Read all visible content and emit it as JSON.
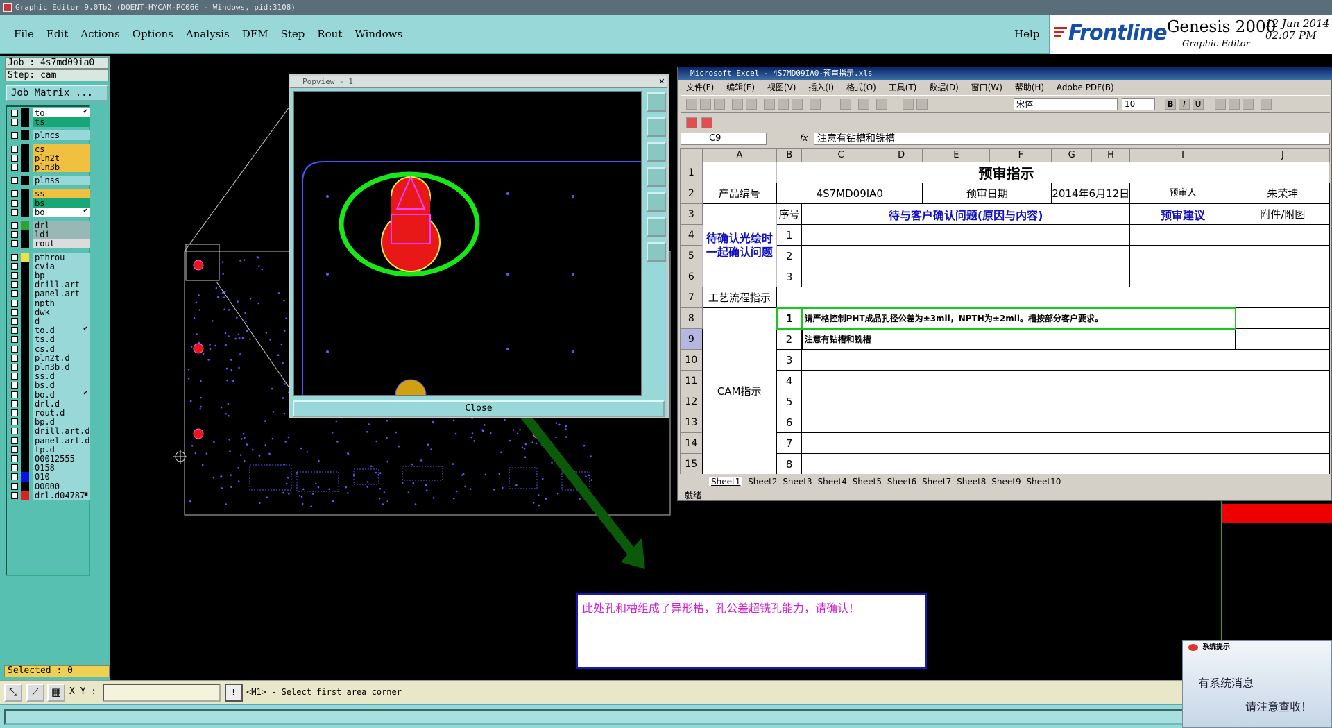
{
  "window_title": "Graphic Editor 9.0Tb2 (DOENT-HYCAM-PC066 - Windows, pid:3108)",
  "menu": [
    "File",
    "Edit",
    "Actions",
    "Options",
    "Analysis",
    "DFM",
    "Step",
    "Rout",
    "Windows"
  ],
  "help_label": "Help",
  "brand": {
    "logo_text": "Frontline",
    "product": "Genesis 2000",
    "subtitle": "Graphic Editor",
    "date": "12 Jun 2014",
    "time": "02:07 PM"
  },
  "left_panel": {
    "job": "Job : 4s7md09ia0",
    "step": "Step: cam",
    "job_matrix": "Job Matrix ...",
    "layers": [
      {
        "name": "to",
        "color": "#ffffff",
        "swatch": "#000000",
        "mark": "✔"
      },
      {
        "name": "ts",
        "color": "#18a878",
        "swatch": "#000000",
        "mark": ""
      },
      {
        "name": "plncs",
        "color": "#98d8d8",
        "swatch": "#000000",
        "mark": ""
      },
      {
        "name": "cs",
        "color": "#f0c040",
        "swatch": "#000000",
        "mark": ""
      },
      {
        "name": "pln2t",
        "color": "#f0c040",
        "swatch": "#000000",
        "mark": ""
      },
      {
        "name": "pln3b",
        "color": "#f0c040",
        "swatch": "#000000",
        "mark": ""
      },
      {
        "name": "plnss",
        "color": "#98d8d8",
        "swatch": "#000000",
        "mark": ""
      },
      {
        "name": "ss",
        "color": "#f0c040",
        "swatch": "#000000",
        "mark": ""
      },
      {
        "name": "bs",
        "color": "#18a878",
        "swatch": "#000000",
        "mark": ""
      },
      {
        "name": "bo",
        "color": "#ffffff",
        "swatch": "#000000",
        "mark": "✔"
      },
      {
        "name": "drl",
        "color": "#98b8b8",
        "swatch": "#30a030",
        "mark": ""
      },
      {
        "name": "ldi",
        "color": "#98b8b8",
        "swatch": "#000000",
        "mark": ""
      },
      {
        "name": "rout",
        "color": "#dcdcdc",
        "swatch": "#000000",
        "mark": ""
      },
      {
        "name": "pthrou",
        "color": "#98d8d8",
        "swatch": "#f0e040",
        "mark": ""
      },
      {
        "name": "cvia",
        "color": "#98d8d8",
        "swatch": "#000000",
        "mark": ""
      },
      {
        "name": "bp",
        "color": "#98d8d8",
        "swatch": "#000000",
        "mark": ""
      },
      {
        "name": "drill.art",
        "color": "#98d8d8",
        "swatch": "#000000",
        "mark": ""
      },
      {
        "name": "panel.art",
        "color": "#98d8d8",
        "swatch": "#000000",
        "mark": ""
      },
      {
        "name": "npth",
        "color": "#98d8d8",
        "swatch": "#000000",
        "mark": ""
      },
      {
        "name": "dwk",
        "color": "#98d8d8",
        "swatch": "#000000",
        "mark": ""
      },
      {
        "name": "d",
        "color": "#98d8d8",
        "swatch": "#000000",
        "mark": ""
      },
      {
        "name": "to.d",
        "color": "#98d8d8",
        "swatch": "#000000",
        "mark": "✔"
      },
      {
        "name": "ts.d",
        "color": "#98d8d8",
        "swatch": "#000000",
        "mark": ""
      },
      {
        "name": "cs.d",
        "color": "#98d8d8",
        "swatch": "#000000",
        "mark": ""
      },
      {
        "name": "pln2t.d",
        "color": "#98d8d8",
        "swatch": "#000000",
        "mark": ""
      },
      {
        "name": "pln3b.d",
        "color": "#98d8d8",
        "swatch": "#000000",
        "mark": ""
      },
      {
        "name": "ss.d",
        "color": "#98d8d8",
        "swatch": "#000000",
        "mark": ""
      },
      {
        "name": "bs.d",
        "color": "#98d8d8",
        "swatch": "#000000",
        "mark": ""
      },
      {
        "name": "bo.d",
        "color": "#98d8d8",
        "swatch": "#000000",
        "mark": "✔"
      },
      {
        "name": "drl.d",
        "color": "#98d8d8",
        "swatch": "#000000",
        "mark": ""
      },
      {
        "name": "rout.d",
        "color": "#98d8d8",
        "swatch": "#000000",
        "mark": ""
      },
      {
        "name": "bp.d",
        "color": "#98d8d8",
        "swatch": "#000000",
        "mark": ""
      },
      {
        "name": "drill.art.d",
        "color": "#98d8d8",
        "swatch": "#000000",
        "mark": ""
      },
      {
        "name": "panel.art.d",
        "color": "#98d8d8",
        "swatch": "#000000",
        "mark": ""
      },
      {
        "name": "tp.d",
        "color": "#98d8d8",
        "swatch": "#000000",
        "mark": ""
      },
      {
        "name": "00012555",
        "color": "#98d8d8",
        "swatch": "#000000",
        "mark": ""
      },
      {
        "name": "0158",
        "color": "#98d8d8",
        "swatch": "#000000",
        "mark": ""
      },
      {
        "name": "010",
        "color": "#98d8d8",
        "swatch": "#1010e0",
        "mark": ""
      },
      {
        "name": "00000",
        "color": "#98d8d8",
        "swatch": "#000000",
        "mark": ""
      },
      {
        "name": "drl.d04787",
        "color": "#98d8d8",
        "swatch": "#e02020",
        "mark": "▪"
      }
    ],
    "selected": "Selected : 0"
  },
  "bottom": {
    "xy_label": "X Y :",
    "xy_value": "",
    "warn": "!",
    "status_message": "<M1> - Select first area corner"
  },
  "popview": {
    "title": "Popview - 1",
    "close_label": "Close"
  },
  "excel": {
    "title": "Microsoft Excel - 4S7MD09IA0-预审指示.xls",
    "menu": [
      "文件(F)",
      "编辑(E)",
      "视图(V)",
      "插入(I)",
      "格式(O)",
      "工具(T)",
      "数据(D)",
      "窗口(W)",
      "帮助(H)",
      "Adobe PDF(B)"
    ],
    "font": "宋体",
    "font_size": "10",
    "name_box": "C9",
    "fx_label": "fx",
    "formula": "注意有钻槽和铣槽",
    "columns": [
      "A",
      "B",
      "C",
      "D",
      "E",
      "F",
      "G",
      "H",
      "I",
      "J"
    ],
    "rows": {
      "title": "预审指示",
      "product_no_label": "产品编号",
      "product_no": "4S7MD09IA0",
      "date_label": "预审日期",
      "date": "2014年6月12日",
      "reviewer_label": "预审人",
      "reviewer": "朱荣坤",
      "attach_label": "附件/附图",
      "seq_label": "序号",
      "issue_header": "待与客户确认问题(原因与内容)",
      "advice_header": "预审建议",
      "confirm_label": "待确认光绘时一起确认问题",
      "process_label": "工艺流程指示",
      "cam_label": "CAM指示",
      "cam_line1": "请严格控制PHT成品孔径公差为±3mil，NPTH为±2mil。槽按部分客户要求。",
      "cam_line2": "注意有钻槽和铣槽",
      "nums_confirm": [
        "1",
        "2",
        "3"
      ],
      "nums_cam": [
        "1",
        "2",
        "3",
        "4",
        "5",
        "6",
        "7",
        "8"
      ],
      "row_numbers": [
        "1",
        "2",
        "3",
        "4",
        "5",
        "6",
        "7",
        "8",
        "9",
        "10",
        "11",
        "12",
        "13",
        "14",
        "15"
      ]
    },
    "sheets": [
      "Sheet1",
      "Sheet2",
      "Sheet3",
      "Sheet4",
      "Sheet5",
      "Sheet6",
      "Sheet7",
      "Sheet8",
      "Sheet9",
      "Sheet10"
    ],
    "status": "就绪"
  },
  "annotation": "此处孔和槽组成了异形槽，孔公差超铣孔能力，请确认！",
  "sys_popup": {
    "title": "系统提示",
    "line1": "有系统消息",
    "line2": "请注意查收！"
  },
  "colors": {
    "accent_green": "#18e818",
    "pad_red": "#e81818",
    "trace_blue": "#5050ff"
  }
}
